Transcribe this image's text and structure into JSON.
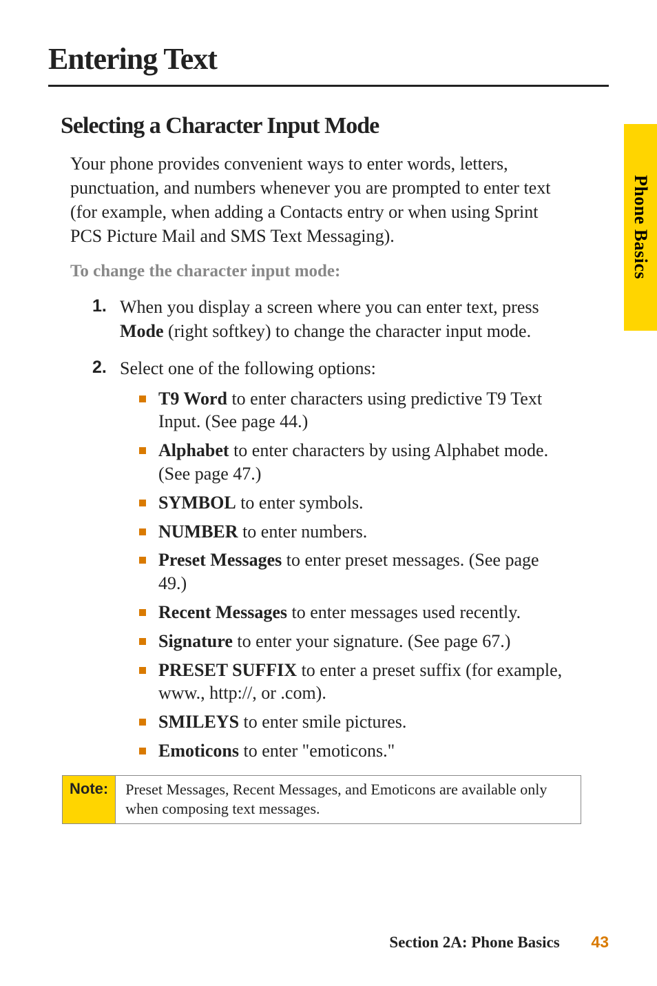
{
  "sideTab": "Phone Basics",
  "title": "Entering Text",
  "subtitle": "Selecting a Character Input Mode",
  "intro": "Your phone provides convenient ways to enter words, letters, punctuation, and numbers whenever you are prompted to enter text (for example, when adding a Contacts entry or when using Sprint PCS Picture Mail and SMS Text Messaging).",
  "lead": "To change the character input mode:",
  "steps": [
    {
      "num": "1.",
      "pre": "When you display a screen where you can enter text, press ",
      "bold": "Mode",
      "post": " (right softkey) to change the character input mode."
    },
    {
      "num": "2.",
      "pre": "Select one of the following options:",
      "bullets": [
        {
          "bold": "T9 Word",
          "rest": " to enter characters using predictive T9 Text Input. (See page 44.)"
        },
        {
          "bold": "Alphabet",
          "rest": " to enter characters by using Alphabet mode. (See page 47.)"
        },
        {
          "bold": "SYMBOL",
          "rest": " to enter symbols."
        },
        {
          "bold": "NUMBER",
          "rest": " to enter numbers."
        },
        {
          "bold": "Preset Messages",
          "rest": " to enter preset messages. (See page 49.)"
        },
        {
          "bold": "Recent Messages",
          "rest": " to enter messages used recently."
        },
        {
          "bold": "Signature",
          "rest": " to enter your signature. (See page 67.)"
        },
        {
          "bold": "PRESET SUFFIX",
          "rest": " to enter a preset suffix (for example, www., http://, or .com)."
        },
        {
          "bold": "SMILEYS",
          "rest": " to enter smile pictures."
        },
        {
          "bold": "Emoticons",
          "rest": " to enter \"emoticons.\""
        }
      ]
    }
  ],
  "note": {
    "label": "Note:",
    "text": "Preset Messages, Recent Messages, and Emoticons are available only when composing text messages."
  },
  "footer": {
    "section": "Section 2A: Phone Basics",
    "page": "43"
  }
}
